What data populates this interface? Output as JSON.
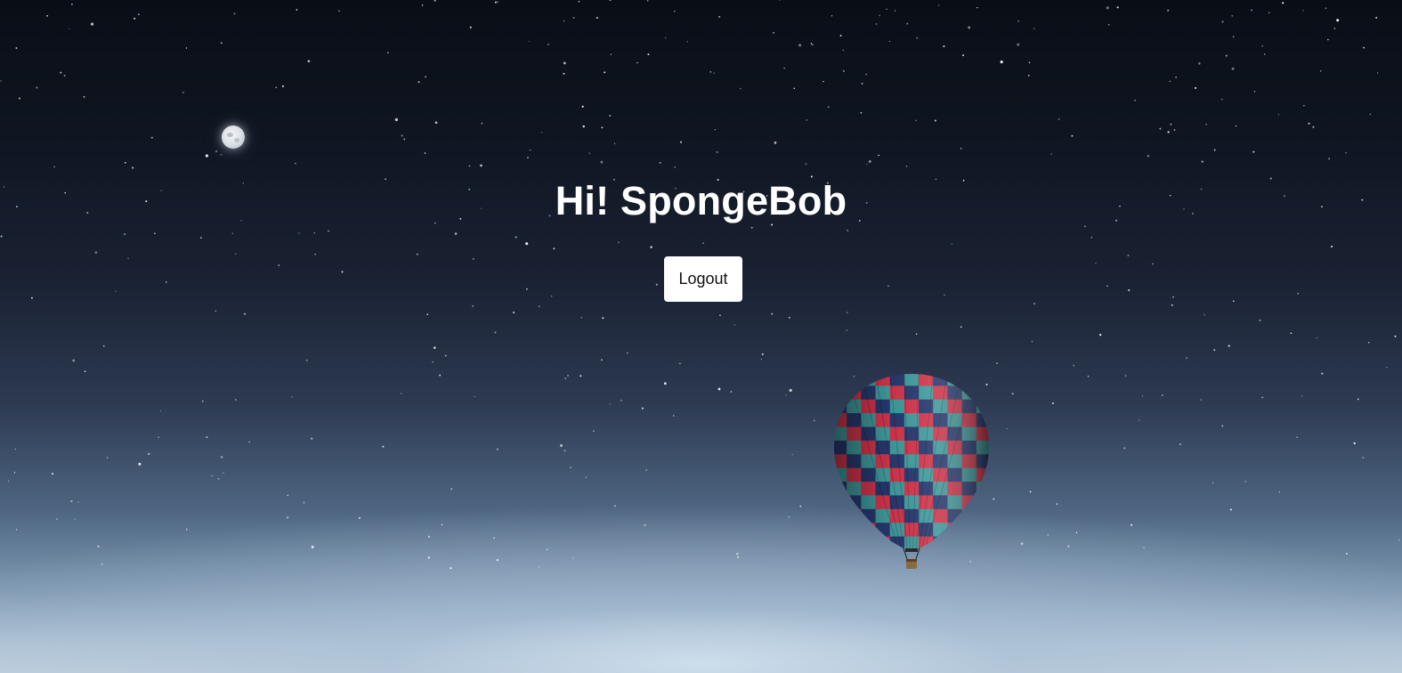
{
  "page": {
    "greeting": "Hi! SpongeBob",
    "logout_label": "Logout"
  },
  "icons": {
    "moon": "moon-icon",
    "balloon": "hot-air-balloon-icon"
  },
  "colors": {
    "sky_top": "#090e16",
    "sky_horizon": "#c1d1df",
    "heading_text": "#ffffff",
    "button_background": "#ffffff",
    "button_text": "#111111",
    "balloon_red": "#d1344b",
    "balloon_teal": "#3f9a9c",
    "balloon_navy": "#27386e"
  }
}
